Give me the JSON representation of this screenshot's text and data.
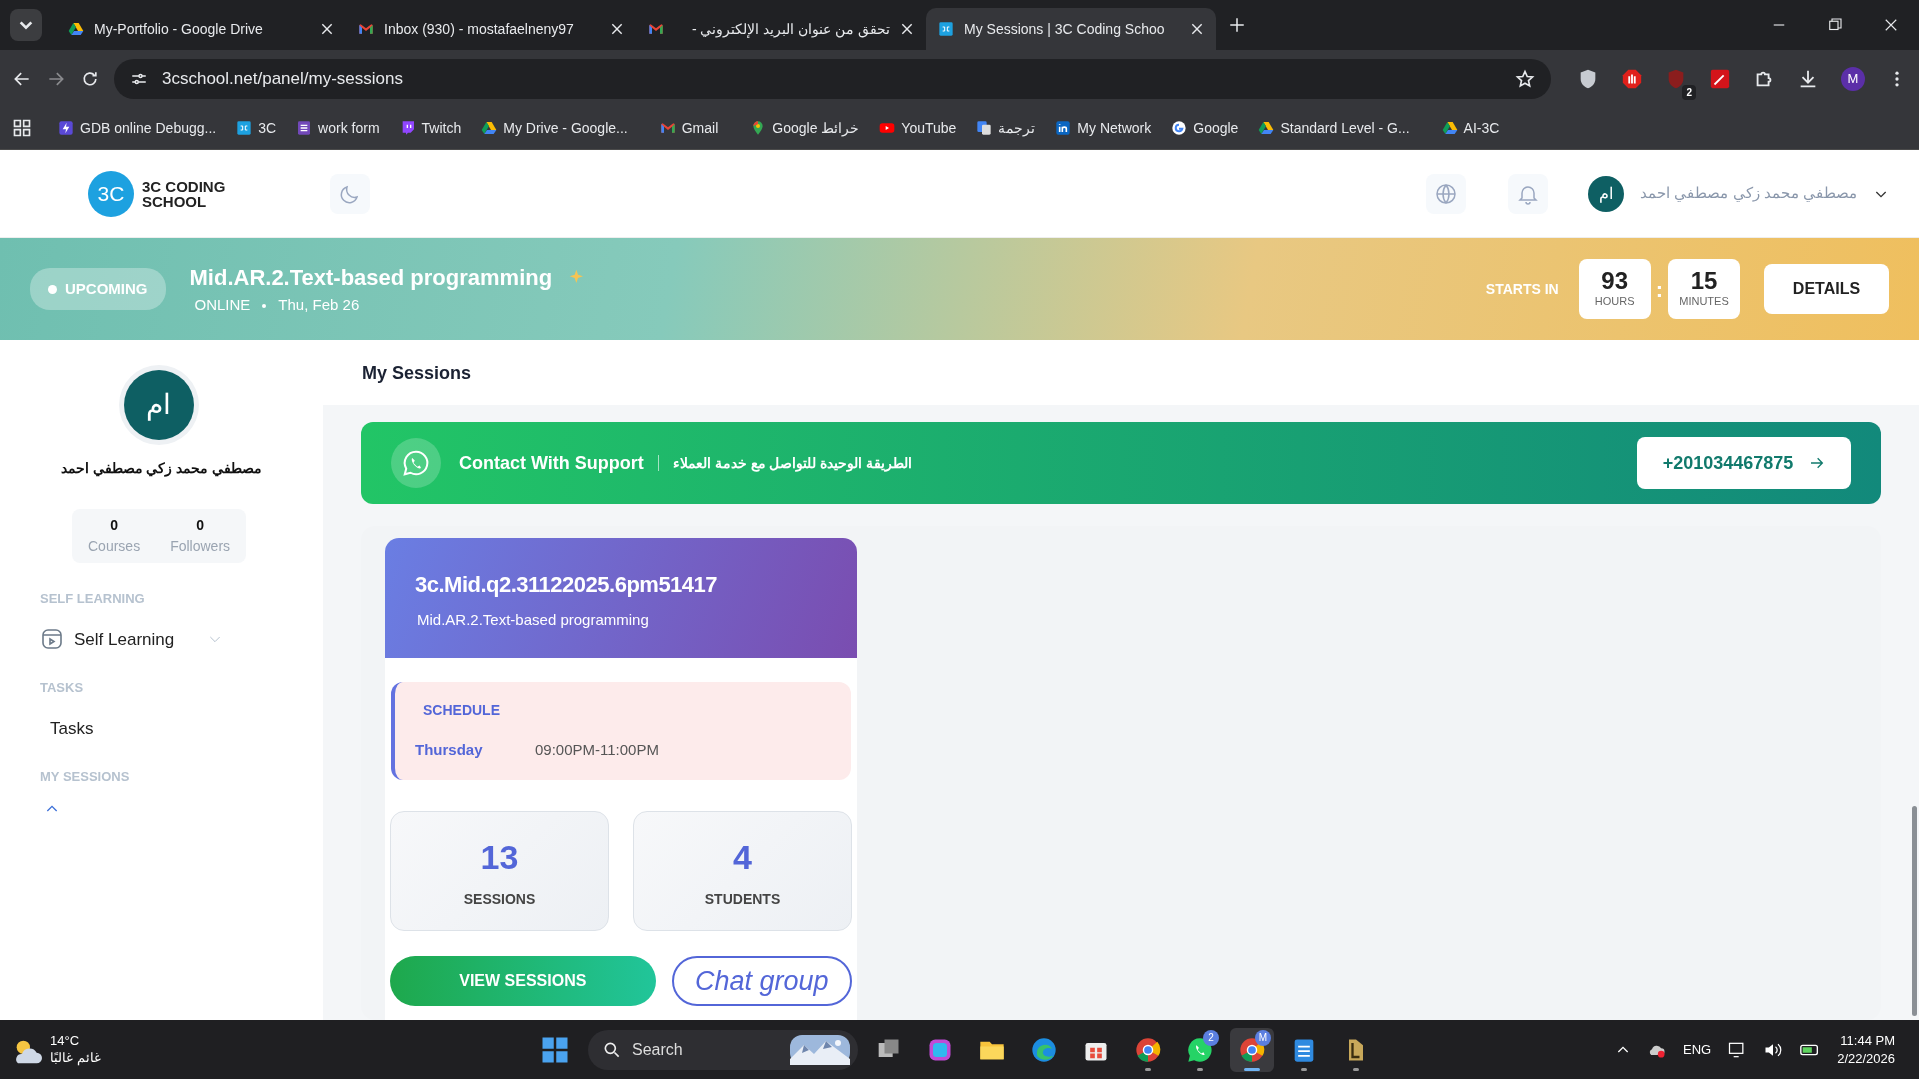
{
  "browser": {
    "tabs": [
      {
        "title": "My-Portfolio - Google Drive",
        "kind": "drive",
        "selected": false
      },
      {
        "title": "Inbox (930) - mostafaelneny97",
        "kind": "gmail",
        "selected": false
      },
      {
        "title": "تحقق من عنوان البريد الإلكتروني -",
        "kind": "gmail",
        "selected": false
      },
      {
        "title": "My Sessions | 3C Coding Schoo",
        "kind": "school",
        "selected": true
      }
    ],
    "url": "3cschool.net/panel/my-sessions",
    "extension_badge": "2",
    "profile_initial": "M",
    "bookmarks": [
      {
        "label": "GDB online Debugg...",
        "kind": "bolt"
      },
      {
        "label": "3C",
        "kind": "school"
      },
      {
        "label": "work form",
        "kind": "form"
      },
      {
        "label": "Twitch",
        "kind": "twitch"
      },
      {
        "label": "My Drive - Google...",
        "kind": "drive"
      },
      {
        "label": "Gmail",
        "kind": "gmail"
      },
      {
        "label": "Google خرائط",
        "kind": "maps"
      },
      {
        "label": "YouTube",
        "kind": "youtube"
      },
      {
        "label": "ترجمة",
        "kind": "translate"
      },
      {
        "label": "My Network",
        "kind": "linkedin"
      },
      {
        "label": "Google",
        "kind": "google"
      },
      {
        "label": "Standard Level - G...",
        "kind": "drive"
      },
      {
        "label": "AI-3C",
        "kind": "drive"
      }
    ]
  },
  "header": {
    "logo_mark": "3C",
    "logo_lines": [
      "3C CODING",
      "SCHOOL"
    ],
    "user_initials": "ام",
    "user_name": "مصطفي محمد زكي مصطفي احمد"
  },
  "banner": {
    "status": "UPCOMING",
    "title": "Mid.AR.2.Text-based programming",
    "mode": "ONLINE",
    "date": "Thu, Feb 26",
    "starts_label": "STARTS IN",
    "separator": ":",
    "countdown": [
      {
        "value": "93",
        "unit": "HOURS"
      },
      {
        "value": "15",
        "unit": "MINUTES"
      }
    ],
    "details": "DETAILS"
  },
  "sidebar": {
    "initials": "ام",
    "name": "مصطفي محمد زكي مصطفي احمد",
    "stats": [
      {
        "value": "0",
        "label": "Courses"
      },
      {
        "value": "0",
        "label": "Followers"
      }
    ],
    "sections": [
      {
        "heading": "SELF LEARNING",
        "items": [
          {
            "label": "Self Learning",
            "kind": "video",
            "expanded": false
          }
        ]
      },
      {
        "heading": "TASKS",
        "items": [
          {
            "label": "Tasks"
          }
        ]
      },
      {
        "heading": "MY SESSIONS",
        "items": [
          {
            "expanded": true
          }
        ]
      }
    ]
  },
  "main": {
    "title": "My Sessions",
    "support": {
      "title": "Contact With Support",
      "subtitle": "الطريقة الوحيدة للتواصل مع خدمة العملاء",
      "phone": "+201034467875"
    },
    "sessions": [
      {
        "code": "3c.Mid.q2.31122025.6pm51417",
        "course": "Mid.AR.2.Text-based programming",
        "schedule_label": "SCHEDULE",
        "day": "Thursday",
        "time": "09:00PM-11:00PM",
        "stats": [
          {
            "value": "13",
            "label": "SESSIONS"
          },
          {
            "value": "4",
            "label": "STUDENTS"
          }
        ],
        "primary": "VIEW SESSIONS",
        "secondary": "Chat group"
      }
    ]
  },
  "taskbar": {
    "temperature": "14°C",
    "weather": "غائم غالبًا",
    "search": "Search",
    "apps": [
      {
        "kind": "taskview",
        "running": false,
        "active": false
      },
      {
        "kind": "m365",
        "running": false,
        "active": false
      },
      {
        "kind": "folder",
        "running": false,
        "active": false
      },
      {
        "kind": "edge",
        "running": false,
        "active": false
      },
      {
        "kind": "store",
        "running": false,
        "active": false
      },
      {
        "kind": "chrome",
        "running": true,
        "active": false
      },
      {
        "kind": "chat",
        "running": true,
        "active": false,
        "badge": "2"
      },
      {
        "kind": "chrome",
        "running": true,
        "active": true,
        "badge": "M"
      },
      {
        "kind": "notepad",
        "running": true,
        "active": false
      },
      {
        "kind": "game",
        "running": true,
        "active": false
      }
    ],
    "language": "ENG",
    "time": "11:44 PM",
    "date": "2/22/2026"
  }
}
